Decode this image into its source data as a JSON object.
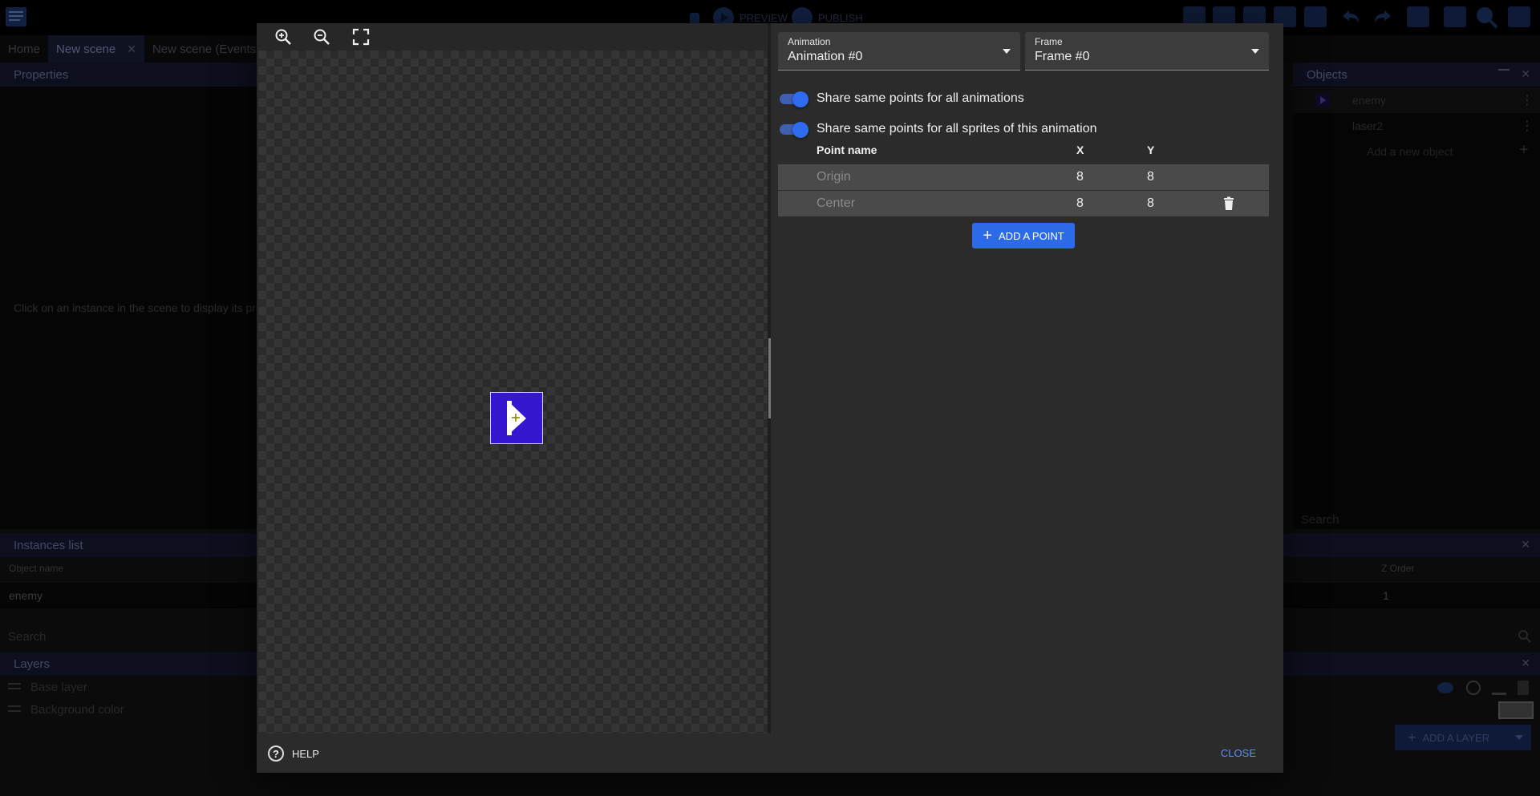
{
  "toolbar": {
    "preview_label": "PREVIEW",
    "publish_label": "PUBLISH"
  },
  "tabs": [
    {
      "label": "Home"
    },
    {
      "label": "New scene",
      "close": "✕"
    },
    {
      "label": "New scene (Events)"
    }
  ],
  "properties": {
    "title": "Properties",
    "hint": "Click on an instance in the scene to display its pro"
  },
  "objects": {
    "title": "Objects",
    "items": [
      {
        "label": "enemy"
      },
      {
        "label": "laser2"
      }
    ],
    "add_label": "Add a new object",
    "search_placeholder": "Search"
  },
  "instances": {
    "title": "Instances list",
    "col_name": "Object name",
    "col_z": "Z Order",
    "rows": [
      {
        "name": "enemy",
        "z": "1"
      }
    ],
    "search_placeholder": "Search"
  },
  "layers": {
    "title": "Layers",
    "items": [
      {
        "label": "Base layer"
      },
      {
        "label": "Background color"
      }
    ],
    "add_label": "ADD A LAYER"
  },
  "dialog": {
    "animation": {
      "label": "Animation",
      "value": "Animation #0"
    },
    "frame": {
      "label": "Frame",
      "value": "Frame #0"
    },
    "toggles": [
      {
        "label": "Share same points for all animations",
        "on": true
      },
      {
        "label": "Share same points for all sprites of this animation",
        "on": true
      }
    ],
    "table": {
      "headers": {
        "name": "Point name",
        "x": "X",
        "y": "Y"
      },
      "rows": [
        {
          "name": "Origin",
          "x": "8",
          "y": "8"
        },
        {
          "name": "Center",
          "x": "8",
          "y": "8"
        }
      ]
    },
    "add_point_label": "ADD A POINT",
    "help_label": "HELP",
    "close_label": "CLOSE"
  },
  "colors": {
    "accent": "#2d6ae8",
    "sprite": "#3617d0",
    "link": "#5a8fff"
  }
}
